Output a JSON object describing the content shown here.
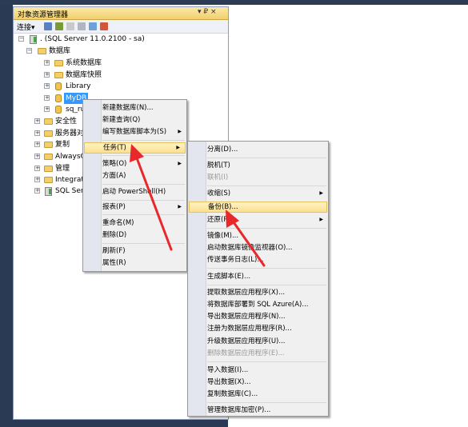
{
  "panel": {
    "title": "对象资源管理器",
    "controls": {
      "pin": "▾ ₽ ×"
    },
    "toolbar": {
      "connect": "连接▾"
    }
  },
  "tree": {
    "server": ". (SQL Server 11.0.2100 - sa)",
    "databases": "数据库",
    "system_dbs": "系统数据库",
    "snapshots": "数据库快照",
    "library": "Library",
    "mydb": "MyDB",
    "sq_ru": "sq_ru",
    "security": "安全性",
    "server_objects": "服务器对",
    "replication": "复制",
    "alwayson": "AlwaysO",
    "management": "管理",
    "integration": "Integrati",
    "sql_server_agent": "SQL Serv"
  },
  "context_menu": {
    "items": [
      "新建数据库(N)...",
      "新建查询(Q)",
      "编写数据库脚本为(S)",
      "任务(T)",
      "策略(O)",
      "方面(A)",
      "启动 PowerShell(H)",
      "报表(P)",
      "重命名(M)",
      "删除(D)",
      "刷新(F)",
      "属性(R)"
    ],
    "arrow": "▶"
  },
  "tasks_menu": {
    "items": [
      "分离(D)...",
      "脱机(T)",
      "联机(I)",
      "收缩(S)",
      "备份(B)...",
      "还原(R)",
      "镜像(M)...",
      "启动数据库镜像监视器(O)...",
      "传送事务日志(L)...",
      "生成脚本(E)...",
      "提取数据层应用程序(X)...",
      "将数据库部署到 SQL Azure(A)...",
      "导出数据层应用程序(N)...",
      "注册为数据层应用程序(R)...",
      "升级数据层应用程序(U)...",
      "删除数据层应用程序(E)...",
      "导入数据(I)...",
      "导出数据(X)...",
      "复制数据库(C)...",
      "管理数据库加密(P)..."
    ]
  },
  "colors": {
    "highlight": "#fbe08f",
    "selection": "#3399ff",
    "annotation_arrow": "#e8282b"
  }
}
